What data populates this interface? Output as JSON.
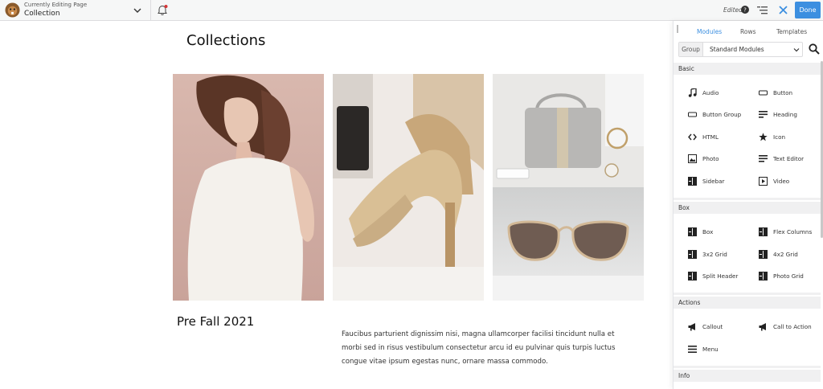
{
  "topbar": {
    "subtitle": "Currently Editing Page",
    "page_name": "Collection",
    "status": "Edited",
    "done_label": "Done",
    "icons": [
      "beaver-logo-icon",
      "chevron-down-icon",
      "notification-bell-icon",
      "help-icon",
      "outline-icon",
      "close-icon"
    ]
  },
  "canvas": {
    "title": "Collections",
    "section_title": "Pre Fall 2021",
    "body_text": "Faucibus parturient dignissim nisi, magna ullamcorper facilisi tincidunt nulla et morbi sed in risus vestibulum consectetur arcu id eu pulvinar quis turpis luctus congue vitae ipsum egestas nunc, ornare massa commodo."
  },
  "panel": {
    "tabs": [
      {
        "label": "Modules",
        "active": true
      },
      {
        "label": "Rows",
        "active": false
      },
      {
        "label": "Templates",
        "active": false
      }
    ],
    "group_label": "Group",
    "group_value": "Standard Modules",
    "accent_color": "#3c8fe0",
    "categories": [
      {
        "name": "Basic",
        "modules": [
          {
            "label": "Audio",
            "icon": "music-note-icon"
          },
          {
            "label": "Button",
            "icon": "button-icon"
          },
          {
            "label": "Button Group",
            "icon": "button-icon"
          },
          {
            "label": "Heading",
            "icon": "heading-icon"
          },
          {
            "label": "HTML",
            "icon": "code-icon"
          },
          {
            "label": "Icon",
            "icon": "star-icon"
          },
          {
            "label": "Photo",
            "icon": "photo-icon"
          },
          {
            "label": "Text Editor",
            "icon": "text-editor-icon"
          },
          {
            "label": "Sidebar",
            "icon": "layout-icon"
          },
          {
            "label": "Video",
            "icon": "video-icon"
          }
        ]
      },
      {
        "name": "Box",
        "modules": [
          {
            "label": "Box",
            "icon": "layout-icon"
          },
          {
            "label": "Flex Columns",
            "icon": "layout-icon"
          },
          {
            "label": "3x2 Grid",
            "icon": "layout-icon"
          },
          {
            "label": "4x2 Grid",
            "icon": "layout-icon"
          },
          {
            "label": "Split Header",
            "icon": "layout-icon"
          },
          {
            "label": "Photo Grid",
            "icon": "layout-icon"
          }
        ]
      },
      {
        "name": "Actions",
        "modules": [
          {
            "label": "Callout",
            "icon": "megaphone-icon"
          },
          {
            "label": "Call to Action",
            "icon": "megaphone-icon"
          },
          {
            "label": "Menu",
            "icon": "menu-icon"
          }
        ]
      },
      {
        "name": "Info",
        "modules": []
      }
    ]
  }
}
